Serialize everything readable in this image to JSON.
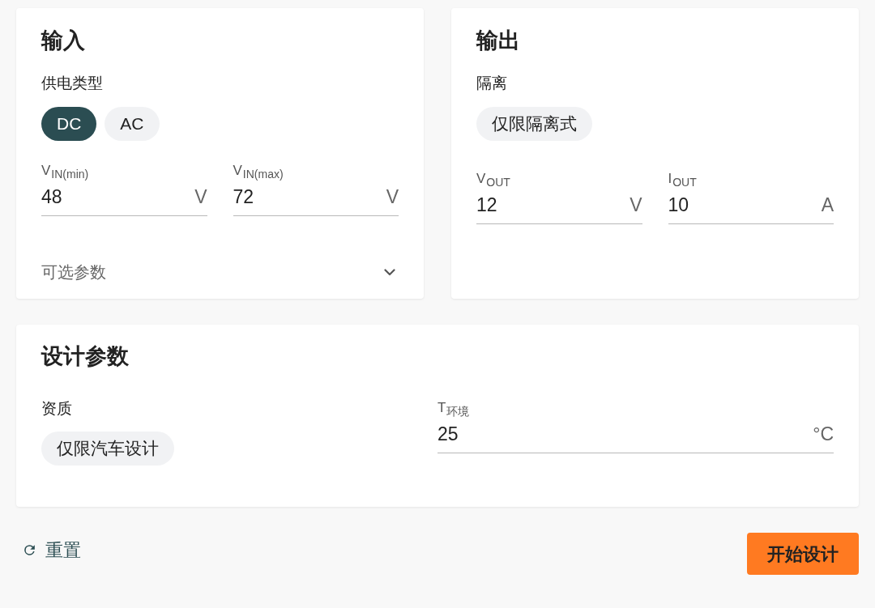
{
  "input": {
    "title": "输入",
    "supply_type": {
      "label": "供电类型",
      "options": [
        {
          "label": "DC",
          "selected": true
        },
        {
          "label": "AC",
          "selected": false
        }
      ]
    },
    "fields": [
      {
        "label": "V$_{IN(min)}$",
        "value": "48",
        "unit": "V"
      },
      {
        "label": "V$_{IN(max)}$",
        "value": "72",
        "unit": "V"
      }
    ],
    "optional_parameters": {
      "label": "可选参数",
      "expanded": false
    }
  },
  "output": {
    "title": "输出",
    "isolation": {
      "label": "隔离",
      "options": [
        {
          "label": "仅限隔离式",
          "selected": false
        }
      ]
    },
    "fields": [
      {
        "label": "V$_{OUT}$",
        "value": "12",
        "unit": "V"
      },
      {
        "label": "I$_{OUT}$",
        "value": "10",
        "unit": "A"
      }
    ]
  },
  "design_parameters": {
    "title": "设计参数",
    "qualification": {
      "label": "资质",
      "options": [
        {
          "label": "仅限汽车设计",
          "selected": false
        }
      ]
    },
    "fields": [
      {
        "label": "T$_{环境}$",
        "value": "25",
        "unit": "°C"
      }
    ]
  },
  "actions": {
    "reset": "重置",
    "start_design": "开始设计"
  }
}
